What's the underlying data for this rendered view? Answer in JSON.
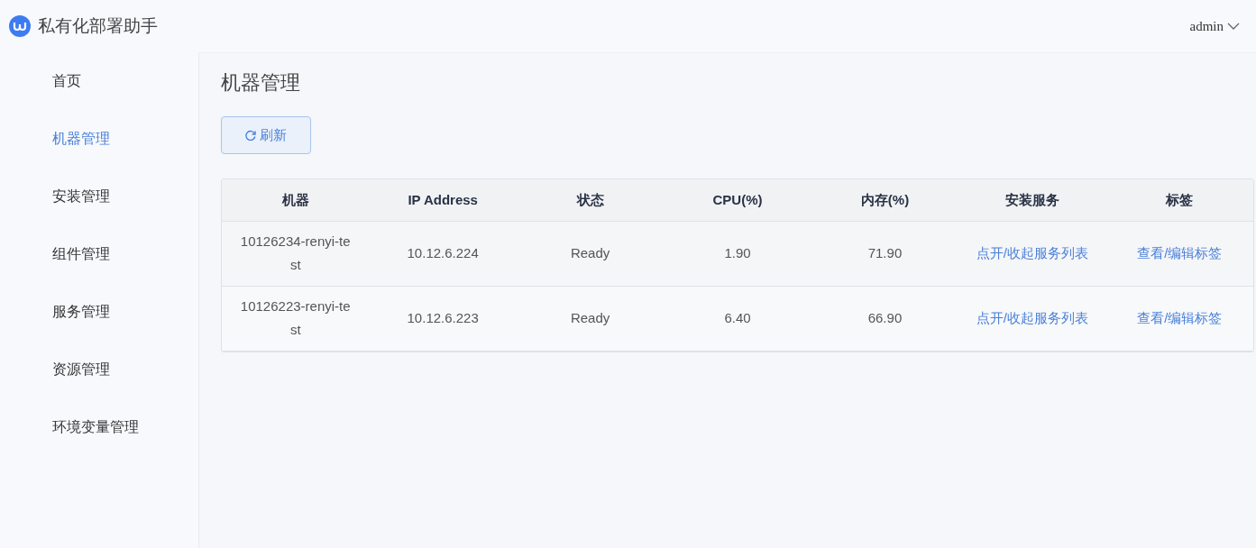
{
  "app": {
    "title": "私有化部署助手",
    "user": "admin"
  },
  "sidebar": {
    "items": [
      {
        "label": "首页",
        "selected": false
      },
      {
        "label": "机器管理",
        "selected": true
      },
      {
        "label": "安装管理",
        "selected": false
      },
      {
        "label": "组件管理",
        "selected": false
      },
      {
        "label": "服务管理",
        "selected": false
      },
      {
        "label": "资源管理",
        "selected": false
      },
      {
        "label": "环境变量管理",
        "selected": false
      }
    ]
  },
  "page": {
    "title": "机器管理",
    "refresh_button": "刷新"
  },
  "table": {
    "columns": [
      "机器",
      "IP Address",
      "状态",
      "CPU(%)",
      "内存(%)",
      "安装服务",
      "标签"
    ],
    "rows": [
      {
        "machine": "10126234-renyi-test",
        "ip": "10.12.6.224",
        "status": "Ready",
        "cpu": "1.90",
        "memory": "71.90",
        "services_link": "点开/收起服务列表",
        "tags_link": "查看/编辑标签"
      },
      {
        "machine": "10126223-renyi-test",
        "ip": "10.12.6.223",
        "status": "Ready",
        "cpu": "6.40",
        "memory": "66.90",
        "services_link": "点开/收起服务列表",
        "tags_link": "查看/编辑标签"
      }
    ]
  }
}
